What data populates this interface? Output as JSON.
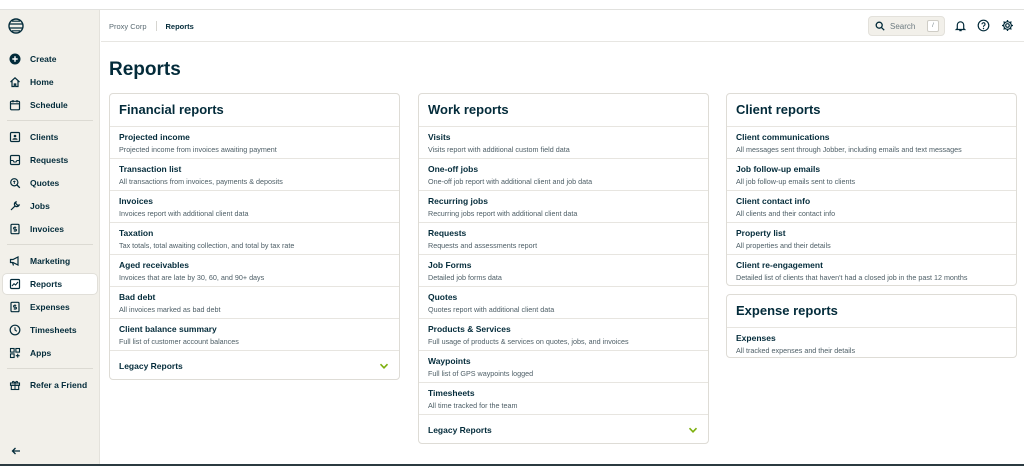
{
  "breadcrumb": {
    "company": "Proxy Corp",
    "current": "Reports"
  },
  "search": {
    "placeholder": "Search",
    "shortcut": "/"
  },
  "sidebar": {
    "items": [
      {
        "label": "Create",
        "icon": "plus-circle-icon"
      },
      {
        "label": "Home",
        "icon": "home-icon"
      },
      {
        "label": "Schedule",
        "icon": "calendar-icon"
      },
      {
        "label": "Clients",
        "icon": "clients-icon"
      },
      {
        "label": "Requests",
        "icon": "requests-icon"
      },
      {
        "label": "Quotes",
        "icon": "quotes-icon"
      },
      {
        "label": "Jobs",
        "icon": "jobs-icon"
      },
      {
        "label": "Invoices",
        "icon": "invoices-icon"
      },
      {
        "label": "Marketing",
        "icon": "marketing-icon"
      },
      {
        "label": "Reports",
        "icon": "reports-icon"
      },
      {
        "label": "Expenses",
        "icon": "expenses-icon"
      },
      {
        "label": "Timesheets",
        "icon": "clock-icon"
      },
      {
        "label": "Apps",
        "icon": "apps-icon"
      },
      {
        "label": "Refer a Friend",
        "icon": "gift-icon"
      }
    ]
  },
  "page": {
    "title": "Reports"
  },
  "financial": {
    "title": "Financial reports",
    "rows": [
      {
        "title": "Projected income",
        "desc": "Projected income from invoices awaiting payment"
      },
      {
        "title": "Transaction list",
        "desc": "All transactions from invoices, payments & deposits"
      },
      {
        "title": "Invoices",
        "desc": "Invoices report with additional client data"
      },
      {
        "title": "Taxation",
        "desc": "Tax totals, total awaiting collection, and total by tax rate"
      },
      {
        "title": "Aged receivables",
        "desc": "Invoices that are late by 30, 60, and 90+ days"
      },
      {
        "title": "Bad debt",
        "desc": "All invoices marked as bad debt"
      },
      {
        "title": "Client balance summary",
        "desc": "Full list of customer account balances"
      }
    ],
    "legacy": "Legacy Reports"
  },
  "work": {
    "title": "Work reports",
    "rows": [
      {
        "title": "Visits",
        "desc": "Visits report with additional custom field data"
      },
      {
        "title": "One-off jobs",
        "desc": "One-off job report with additional client and job data"
      },
      {
        "title": "Recurring jobs",
        "desc": "Recurring jobs report with additional client data"
      },
      {
        "title": "Requests",
        "desc": "Requests and assessments report"
      },
      {
        "title": "Job Forms",
        "desc": "Detailed job forms data"
      },
      {
        "title": "Quotes",
        "desc": "Quotes report with additional client data"
      },
      {
        "title": "Products & Services",
        "desc": "Full usage of products & services on quotes, jobs, and invoices"
      },
      {
        "title": "Waypoints",
        "desc": "Full list of GPS waypoints logged"
      },
      {
        "title": "Timesheets",
        "desc": "All time tracked for the team"
      }
    ],
    "legacy": "Legacy Reports"
  },
  "client": {
    "title": "Client reports",
    "rows": [
      {
        "title": "Client communications",
        "desc": "All messages sent through Jobber, including emails and text messages"
      },
      {
        "title": "Job follow-up emails",
        "desc": "All job follow-up emails sent to clients"
      },
      {
        "title": "Client contact info",
        "desc": "All clients and their contact info"
      },
      {
        "title": "Property list",
        "desc": "All properties and their details"
      },
      {
        "title": "Client re-engagement",
        "desc": "Detailed list of clients that haven't had a closed job in the past 12 months"
      }
    ]
  },
  "expense": {
    "title": "Expense reports",
    "rows": [
      {
        "title": "Expenses",
        "desc": "All tracked expenses and their details"
      }
    ]
  },
  "colors": {
    "navy": "#032b3a",
    "green": "#7db00e",
    "sidebar_bg": "#f2f0ea"
  }
}
